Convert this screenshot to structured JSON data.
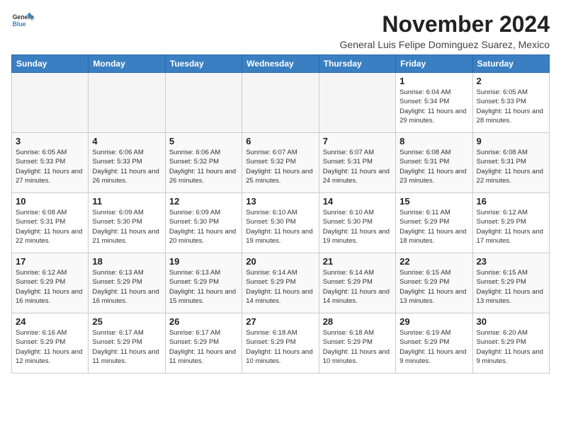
{
  "header": {
    "logo_line1": "General",
    "logo_line2": "Blue",
    "month": "November 2024",
    "location": "General Luis Felipe Dominguez Suarez, Mexico"
  },
  "weekdays": [
    "Sunday",
    "Monday",
    "Tuesday",
    "Wednesday",
    "Thursday",
    "Friday",
    "Saturday"
  ],
  "weeks": [
    [
      {
        "day": "",
        "info": ""
      },
      {
        "day": "",
        "info": ""
      },
      {
        "day": "",
        "info": ""
      },
      {
        "day": "",
        "info": ""
      },
      {
        "day": "",
        "info": ""
      },
      {
        "day": "1",
        "info": "Sunrise: 6:04 AM\nSunset: 5:34 PM\nDaylight: 11 hours and 29 minutes."
      },
      {
        "day": "2",
        "info": "Sunrise: 6:05 AM\nSunset: 5:33 PM\nDaylight: 11 hours and 28 minutes."
      }
    ],
    [
      {
        "day": "3",
        "info": "Sunrise: 6:05 AM\nSunset: 5:33 PM\nDaylight: 11 hours and 27 minutes."
      },
      {
        "day": "4",
        "info": "Sunrise: 6:06 AM\nSunset: 5:33 PM\nDaylight: 11 hours and 26 minutes."
      },
      {
        "day": "5",
        "info": "Sunrise: 6:06 AM\nSunset: 5:32 PM\nDaylight: 11 hours and 26 minutes."
      },
      {
        "day": "6",
        "info": "Sunrise: 6:07 AM\nSunset: 5:32 PM\nDaylight: 11 hours and 25 minutes."
      },
      {
        "day": "7",
        "info": "Sunrise: 6:07 AM\nSunset: 5:31 PM\nDaylight: 11 hours and 24 minutes."
      },
      {
        "day": "8",
        "info": "Sunrise: 6:08 AM\nSunset: 5:31 PM\nDaylight: 11 hours and 23 minutes."
      },
      {
        "day": "9",
        "info": "Sunrise: 6:08 AM\nSunset: 5:31 PM\nDaylight: 11 hours and 22 minutes."
      }
    ],
    [
      {
        "day": "10",
        "info": "Sunrise: 6:08 AM\nSunset: 5:31 PM\nDaylight: 11 hours and 22 minutes."
      },
      {
        "day": "11",
        "info": "Sunrise: 6:09 AM\nSunset: 5:30 PM\nDaylight: 11 hours and 21 minutes."
      },
      {
        "day": "12",
        "info": "Sunrise: 6:09 AM\nSunset: 5:30 PM\nDaylight: 11 hours and 20 minutes."
      },
      {
        "day": "13",
        "info": "Sunrise: 6:10 AM\nSunset: 5:30 PM\nDaylight: 11 hours and 19 minutes."
      },
      {
        "day": "14",
        "info": "Sunrise: 6:10 AM\nSunset: 5:30 PM\nDaylight: 11 hours and 19 minutes."
      },
      {
        "day": "15",
        "info": "Sunrise: 6:11 AM\nSunset: 5:29 PM\nDaylight: 11 hours and 18 minutes."
      },
      {
        "day": "16",
        "info": "Sunrise: 6:12 AM\nSunset: 5:29 PM\nDaylight: 11 hours and 17 minutes."
      }
    ],
    [
      {
        "day": "17",
        "info": "Sunrise: 6:12 AM\nSunset: 5:29 PM\nDaylight: 11 hours and 16 minutes."
      },
      {
        "day": "18",
        "info": "Sunrise: 6:13 AM\nSunset: 5:29 PM\nDaylight: 11 hours and 16 minutes."
      },
      {
        "day": "19",
        "info": "Sunrise: 6:13 AM\nSunset: 5:29 PM\nDaylight: 11 hours and 15 minutes."
      },
      {
        "day": "20",
        "info": "Sunrise: 6:14 AM\nSunset: 5:29 PM\nDaylight: 11 hours and 14 minutes."
      },
      {
        "day": "21",
        "info": "Sunrise: 6:14 AM\nSunset: 5:29 PM\nDaylight: 11 hours and 14 minutes."
      },
      {
        "day": "22",
        "info": "Sunrise: 6:15 AM\nSunset: 5:29 PM\nDaylight: 11 hours and 13 minutes."
      },
      {
        "day": "23",
        "info": "Sunrise: 6:15 AM\nSunset: 5:29 PM\nDaylight: 11 hours and 13 minutes."
      }
    ],
    [
      {
        "day": "24",
        "info": "Sunrise: 6:16 AM\nSunset: 5:29 PM\nDaylight: 11 hours and 12 minutes."
      },
      {
        "day": "25",
        "info": "Sunrise: 6:17 AM\nSunset: 5:29 PM\nDaylight: 11 hours and 11 minutes."
      },
      {
        "day": "26",
        "info": "Sunrise: 6:17 AM\nSunset: 5:29 PM\nDaylight: 11 hours and 11 minutes."
      },
      {
        "day": "27",
        "info": "Sunrise: 6:18 AM\nSunset: 5:29 PM\nDaylight: 11 hours and 10 minutes."
      },
      {
        "day": "28",
        "info": "Sunrise: 6:18 AM\nSunset: 5:29 PM\nDaylight: 11 hours and 10 minutes."
      },
      {
        "day": "29",
        "info": "Sunrise: 6:19 AM\nSunset: 5:29 PM\nDaylight: 11 hours and 9 minutes."
      },
      {
        "day": "30",
        "info": "Sunrise: 6:20 AM\nSunset: 5:29 PM\nDaylight: 11 hours and 9 minutes."
      }
    ]
  ]
}
